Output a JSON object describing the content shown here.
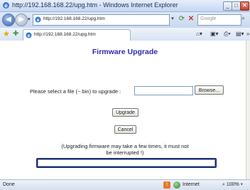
{
  "window": {
    "title": "http://192.168.168.22/upg.htm - Windows Internet Explorer",
    "min_glyph": "_",
    "max_glyph": "□",
    "close_glyph": "✕"
  },
  "address_bar": {
    "url": "http://192.168.168.22/upg.htm",
    "search_placeholder": "Google"
  },
  "tab": {
    "title": "http://192.168.168.22/upg.htm"
  },
  "page": {
    "heading": "Firmware Upgrade",
    "file_prompt": "Please select a file (~.bin) to upgrade :",
    "browse_label": "Browse...",
    "upgrade_label": "Upgrade",
    "cancel_label": "Cancel",
    "note_line1": "(Upgrading firmware may take a few times, it must not",
    "note_line2": "be interrupted !)",
    "progress_fraction": 0
  },
  "status_bar": {
    "status": "Done",
    "zone": "Internet",
    "zoom": "100%"
  },
  "icons": {
    "back": "back-arrow-icon",
    "forward": "forward-arrow-icon",
    "refresh": "refresh-icon",
    "stop": "stop-icon",
    "search": "search-icon",
    "favorites": "favorites-star-icon",
    "add_favorite": "add-favorite-icon",
    "home": "home-icon",
    "feeds": "feeds-icon",
    "print": "print-icon",
    "page_menu": "page-menu-icon"
  },
  "colors": {
    "heading": "#2b2bb0",
    "progress_border": "#1f2d6b",
    "titlebar": "#c6d7f1"
  }
}
